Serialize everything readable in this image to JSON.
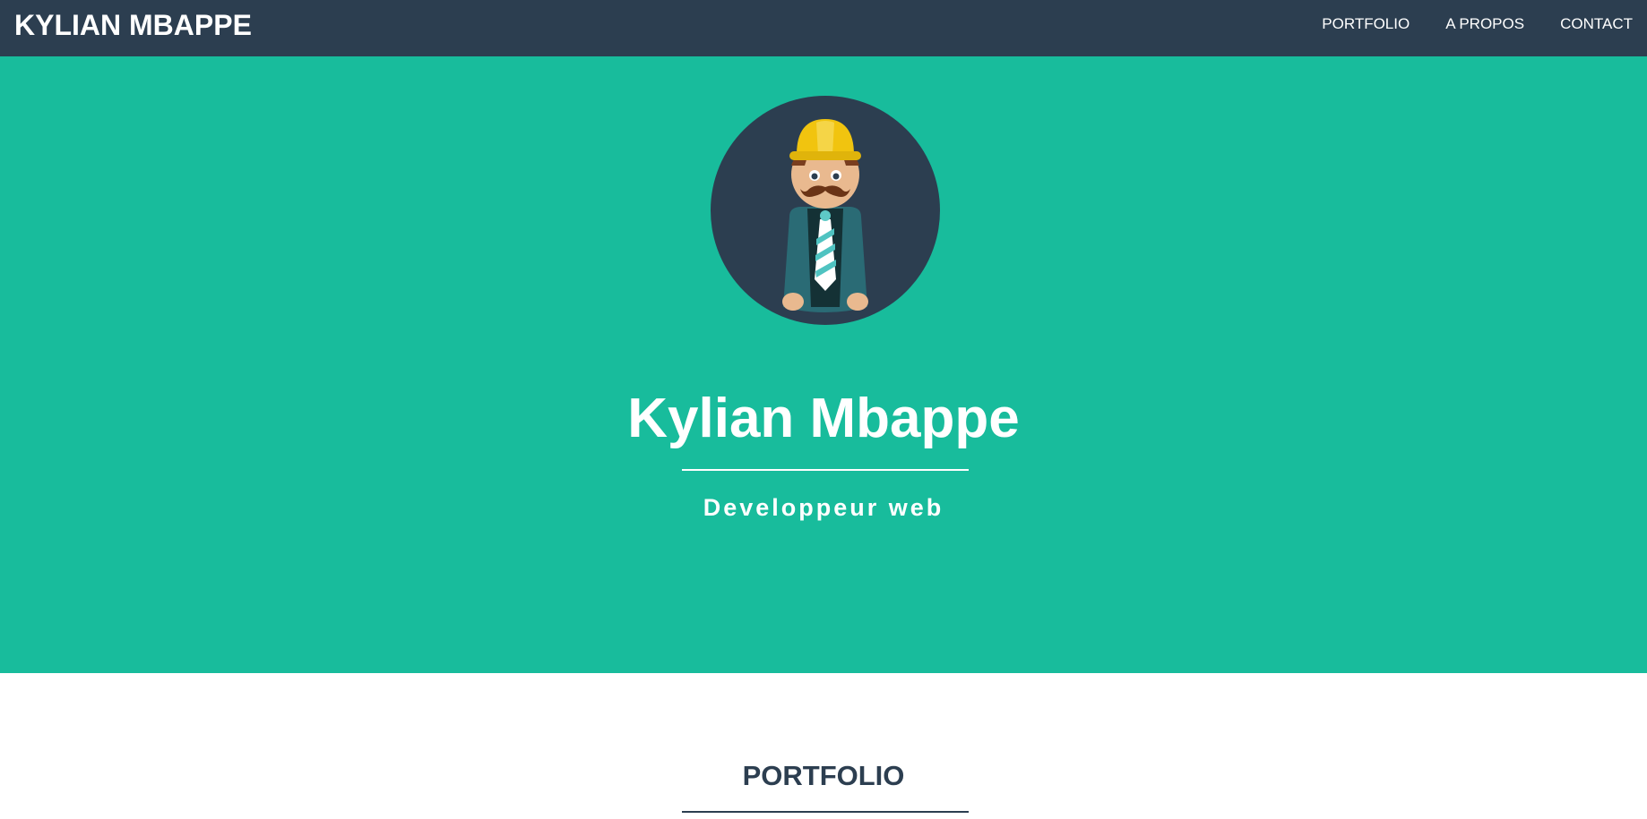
{
  "navbar": {
    "brand": "KYLIAN MBAPPE",
    "links": [
      {
        "label": "PORTFOLIO"
      },
      {
        "label": "A PROPOS"
      },
      {
        "label": "CONTACT"
      }
    ]
  },
  "hero": {
    "avatar_icon": "construction-worker-avatar-icon",
    "name": "Kylian Mbappe",
    "tagline": "Developpeur web"
  },
  "portfolio": {
    "title": "PORTFOLIO"
  },
  "colors": {
    "navbar_bg": "#2c3e50",
    "hero_bg": "#18bc9c",
    "heading_dark": "#2c3e50"
  }
}
